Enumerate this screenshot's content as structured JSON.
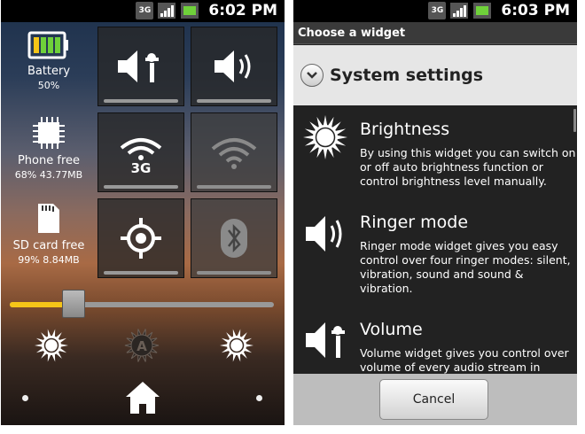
{
  "left_screen": {
    "status_bar": {
      "network": "3G",
      "time": "6:02 PM"
    },
    "info": [
      {
        "label": "Battery",
        "value": "50%",
        "icon": "battery-icon"
      },
      {
        "label": "Phone free",
        "value": "68%  43.77MB",
        "icon": "chip-icon"
      },
      {
        "label": "SD card free",
        "value": "99%  8.84MB",
        "icon": "sd-card-icon"
      }
    ],
    "toggles": [
      {
        "name": "volume-toggle",
        "icon": "volume-icon",
        "state": "on"
      },
      {
        "name": "ringer-toggle",
        "icon": "speaker-icon",
        "state": "on"
      },
      {
        "name": "3g-toggle",
        "icon": "3g-icon",
        "label": "3G",
        "state": "on"
      },
      {
        "name": "wifi-toggle",
        "icon": "wifi-icon",
        "state": "off"
      },
      {
        "name": "gps-toggle",
        "icon": "gps-icon",
        "state": "on"
      },
      {
        "name": "bluetooth-toggle",
        "icon": "bluetooth-icon",
        "state": "off"
      }
    ],
    "brightness_level": 0.24,
    "bottom_icons": [
      "brightness-low-icon",
      "brightness-auto-icon",
      "brightness-high-icon"
    ],
    "auto_label": "A"
  },
  "right_screen": {
    "status_bar": {
      "network": "3G",
      "time": "6:03 PM"
    },
    "dialog_title": "Choose a widget",
    "group_label": "System settings",
    "widgets": [
      {
        "title": "Brightness",
        "description": "By using this widget you can switch on or off auto brightness function or control brightness level manually.",
        "icon": "brightness-icon"
      },
      {
        "title": "Ringer mode",
        "description": "Ringer mode widget gives you easy control over four ringer modes: silent, vibration, sound and sound & vibration.",
        "icon": "ringer-icon"
      },
      {
        "title": "Volume",
        "description": "Volume widget gives you control over volume of every audio stream in",
        "icon": "volume-icon"
      }
    ],
    "cancel_label": "Cancel"
  },
  "colors": {
    "slider_fill": "#f5c518",
    "status_bar": "#000000",
    "dialog_footer": "#bdbdbd"
  }
}
